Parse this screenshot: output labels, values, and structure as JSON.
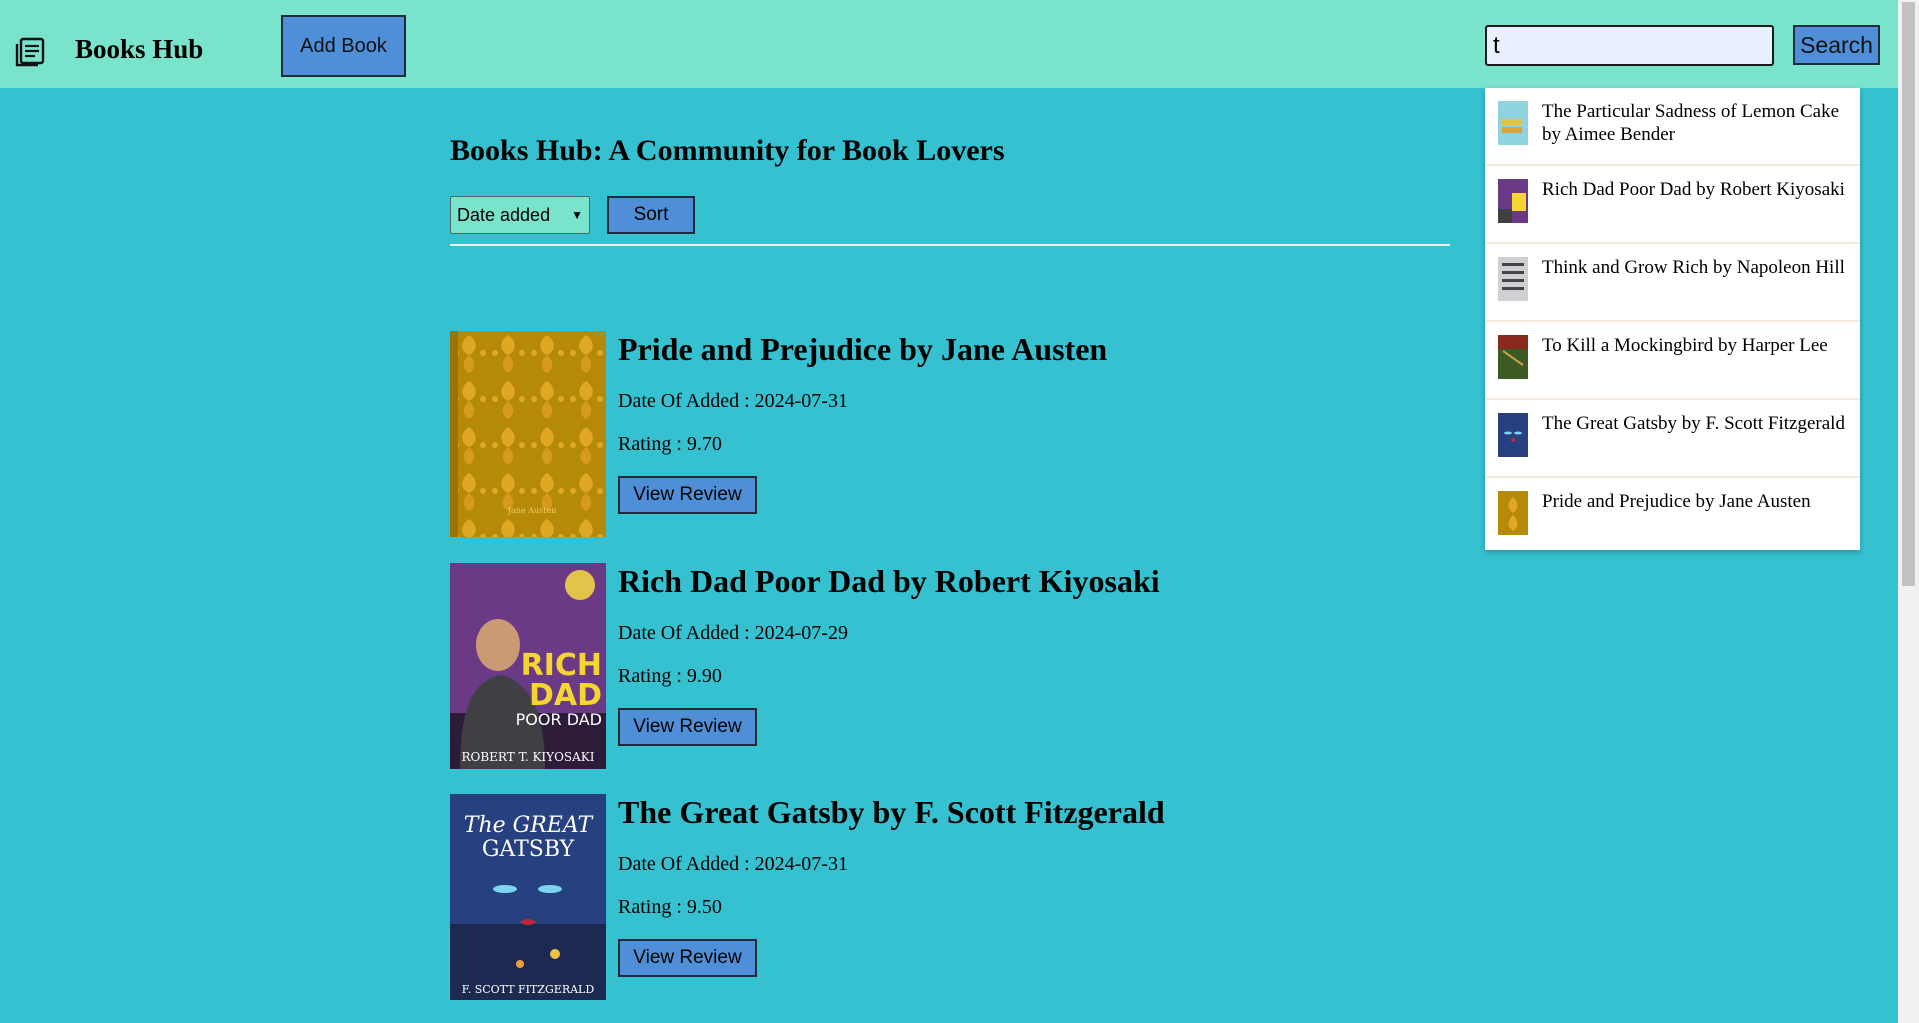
{
  "navbar": {
    "brand": "Books Hub",
    "add_book_label": "Add Book",
    "search_value": "t",
    "search_button_label": "Search"
  },
  "main": {
    "heading": "Books Hub: A Community for Book Lovers",
    "sort_selected": "Date added",
    "sort_button_label": "Sort"
  },
  "books": [
    {
      "title": "Pride and Prejudice by Jane Austen",
      "date": "Date Of Added : 2024-07-31",
      "rating": "Rating : 9.70",
      "review_label": "View Review",
      "cover_text": "Jane Austen"
    },
    {
      "title": "Rich Dad Poor Dad by Robert Kiyosaki",
      "date": "Date Of Added : 2024-07-29",
      "rating": "Rating : 9.90",
      "review_label": "View Review",
      "cover_rich": "RICH",
      "cover_dad": "DAD",
      "cover_poordad": "POOR DAD",
      "cover_author": "ROBERT T. KIYOSAKI"
    },
    {
      "title": "The Great Gatsby by F. Scott Fitzgerald",
      "date": "Date Of Added : 2024-07-31",
      "rating": "Rating : 9.50",
      "review_label": "View Review",
      "cover_line1": "The GREAT",
      "cover_line2": "GATSBY",
      "cover_author": "F. SCOTT FITZGERALD"
    }
  ],
  "suggestions": [
    {
      "text": "The Particular Sadness of Lemon Cake by Aimee Bender"
    },
    {
      "text": "Rich Dad Poor Dad by Robert Kiyosaki"
    },
    {
      "text": "Think and Grow Rich by Napoleon Hill"
    },
    {
      "text": "To Kill a Mockingbird by Harper Lee"
    },
    {
      "text": "The Great Gatsby by F. Scott Fitzgerald"
    },
    {
      "text": "Pride and Prejudice by Jane Austen"
    }
  ],
  "colors": {
    "navbar": "#79e3cc",
    "background": "#35c1d0",
    "button": "#4f8fd8"
  }
}
